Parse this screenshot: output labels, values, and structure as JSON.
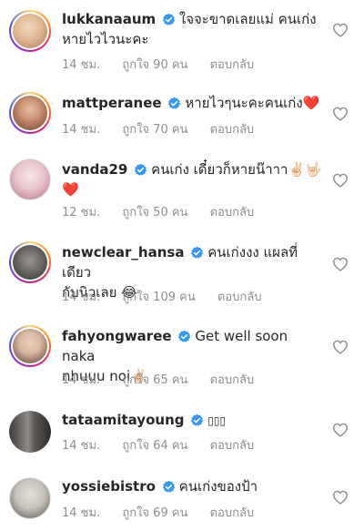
{
  "comments": [
    {
      "username": "lukkanaaum",
      "text_line1": "ใจจะขาดเลยแม่ คนเก่ง",
      "text_line2": "หายไวไวนะคะ",
      "time": "14 ชม.",
      "likes": "ถูกใจ 90 คน",
      "reply": "ตอบกลับ",
      "avatar_colors": [
        "#e8c9a8",
        "#a7745a"
      ]
    },
    {
      "username": "mattperanee",
      "text_line1": "หายไวๆนะคะคนเก่ง",
      "emoji": "❤️",
      "time": "14 ชม.",
      "likes": "ถูกใจ 70 คน",
      "reply": "ตอบกลับ",
      "avatar_colors": [
        "#d9a98a",
        "#6b3b2a"
      ]
    },
    {
      "username": "vanda29",
      "text_line1": "คนเก่ง เดี๋ยวก็หายน๊าาา",
      "emoji_inline": "✌🏻🤟🏻",
      "emoji_line2": "❤️",
      "time": "12 ชม.",
      "likes": "ถูกใจ 50 คน",
      "reply": "ตอบกลับ",
      "avatar_colors": [
        "#f0dce0",
        "#b36f7e"
      ]
    },
    {
      "username": "newclear_hansa",
      "text_line1": "คนเก่งงง แผลที่เดียว",
      "text_line2": "กับนิวเลย",
      "emoji": "😂",
      "time": "14 ชม.",
      "likes": "ถูกใจ 109 คน",
      "reply": "ตอบกลับ",
      "avatar_colors": [
        "#6d6a66",
        "#2e2a27"
      ]
    },
    {
      "username": "fahyongwaree",
      "text_line1": "Get well soon naka",
      "text_line2": "nhuuu noi",
      "emoji": "✌🏻",
      "time": "14 ชม.",
      "likes": "ถูกใจ 65 คน",
      "reply": "ตอบกลับ",
      "avatar_colors": [
        "#d8b7a2",
        "#553628"
      ]
    },
    {
      "username": "tataamitayoung",
      "text_line1": "▯▯▯",
      "time": "14 ชม.",
      "likes": "ถูกใจ 64 คน",
      "reply": "ตอบกลับ",
      "avatar_colors": [
        "#8f8a84",
        "#3c3a38"
      ]
    },
    {
      "username": "yossiebistro",
      "text_line1": "คนเก่งของป้า",
      "time": "14 ชม.",
      "likes": "ถูกใจ 69 คน",
      "reply": "ตอบกลับ",
      "avatar_colors": [
        "#c7c2ba",
        "#55514c"
      ]
    }
  ],
  "colors": {
    "verified": "#3897f0",
    "meta": "#8e8e8e",
    "text": "#262626",
    "heart_red": "#ed2c2c"
  }
}
